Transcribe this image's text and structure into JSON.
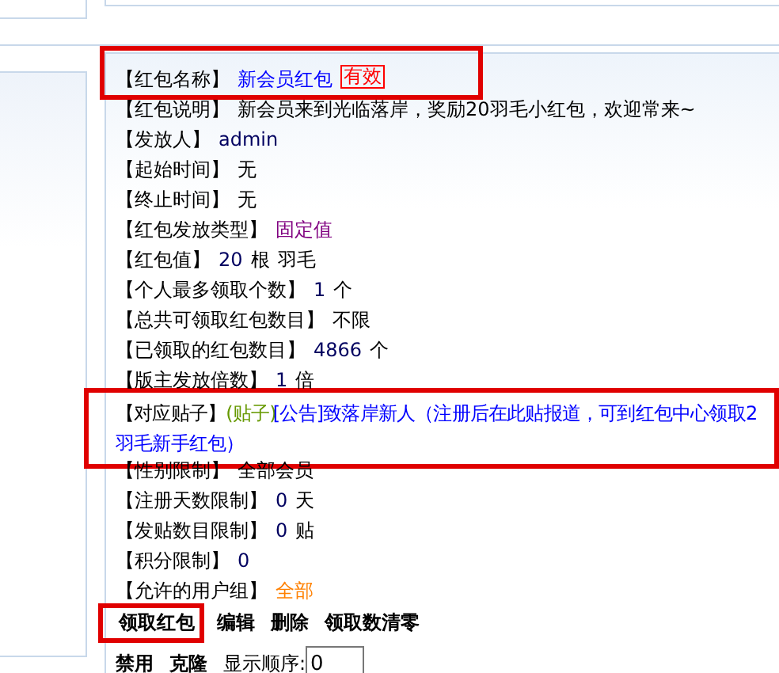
{
  "fields": [
    {
      "label": "【红包名称】",
      "highlighted": true,
      "values": [
        {
          "text": "新会员红包",
          "kind": "link"
        },
        {
          "text": "有效",
          "kind": "status"
        }
      ]
    },
    {
      "label": "【红包说明】",
      "highlighted": false,
      "values": [
        {
          "text": "新会员来到光临落岸，奖励20羽毛小红包，欢迎常来~",
          "kind": "plain"
        }
      ]
    },
    {
      "label": "【发放人】",
      "highlighted": false,
      "values": [
        {
          "text": "admin",
          "kind": "navy"
        }
      ]
    },
    {
      "label": "【起始时间】",
      "highlighted": false,
      "values": [
        {
          "text": "无",
          "kind": "plain"
        }
      ]
    },
    {
      "label": "【终止时间】",
      "highlighted": false,
      "values": [
        {
          "text": "无",
          "kind": "plain"
        }
      ]
    },
    {
      "label": "【红包发放类型】",
      "highlighted": false,
      "values": [
        {
          "text": "固定值",
          "kind": "purple"
        }
      ]
    },
    {
      "label": "【红包值】",
      "highlighted": false,
      "values": [
        {
          "text": "20",
          "kind": "navy"
        },
        {
          "text": "根",
          "kind": "plain"
        },
        {
          "text": "羽毛",
          "kind": "plain"
        }
      ]
    },
    {
      "label": "【个人最多领取个数】",
      "highlighted": false,
      "values": [
        {
          "text": "1",
          "kind": "navy"
        },
        {
          "text": "个",
          "kind": "plain"
        }
      ]
    },
    {
      "label": "【总共可领取红包数目】",
      "highlighted": false,
      "values": [
        {
          "text": "不限",
          "kind": "plain"
        }
      ]
    },
    {
      "label": "【已领取的红包数目】",
      "highlighted": false,
      "values": [
        {
          "text": "4866",
          "kind": "navy"
        },
        {
          "text": "个",
          "kind": "plain"
        }
      ]
    },
    {
      "label": "【版主发放倍数】",
      "highlighted": false,
      "values": [
        {
          "text": "1",
          "kind": "navy"
        },
        {
          "text": "倍",
          "kind": "plain"
        }
      ]
    },
    {
      "label": "【对应贴子】",
      "highlighted": true,
      "values": [
        {
          "text": "(贴子)",
          "kind": "tag"
        },
        {
          "text": "[公告]致落岸新人（注册后在此贴报道，可到红包中心领取2",
          "kind": "link"
        },
        {
          "text": "羽毛新手红包）",
          "kind": "link",
          "new_line": true
        }
      ]
    },
    {
      "label": "【性别限制】",
      "highlighted": false,
      "values": [
        {
          "text": "全部会员",
          "kind": "plain"
        }
      ]
    },
    {
      "label": "【注册天数限制】",
      "highlighted": false,
      "values": [
        {
          "text": "0",
          "kind": "navy"
        },
        {
          "text": "天",
          "kind": "plain"
        }
      ]
    },
    {
      "label": "【发贴数目限制】",
      "highlighted": false,
      "values": [
        {
          "text": "0",
          "kind": "navy"
        },
        {
          "text": "贴",
          "kind": "plain"
        }
      ]
    },
    {
      "label": "【积分限制】",
      "highlighted": false,
      "values": [
        {
          "text": "0",
          "kind": "navy"
        }
      ]
    },
    {
      "label": "【允许的用户组】",
      "highlighted": false,
      "values": [
        {
          "text": "全部",
          "kind": "orange"
        }
      ]
    }
  ],
  "actions": [
    {
      "label": "领取红包",
      "highlighted": true
    },
    {
      "label": "编辑",
      "highlighted": false
    },
    {
      "label": "删除",
      "highlighted": false
    },
    {
      "label": "领取数清零",
      "highlighted": false
    }
  ],
  "actions_2": [
    {
      "label": "禁用"
    },
    {
      "label": "克隆"
    }
  ],
  "order": {
    "label": "显示顺序:",
    "value": "0"
  }
}
